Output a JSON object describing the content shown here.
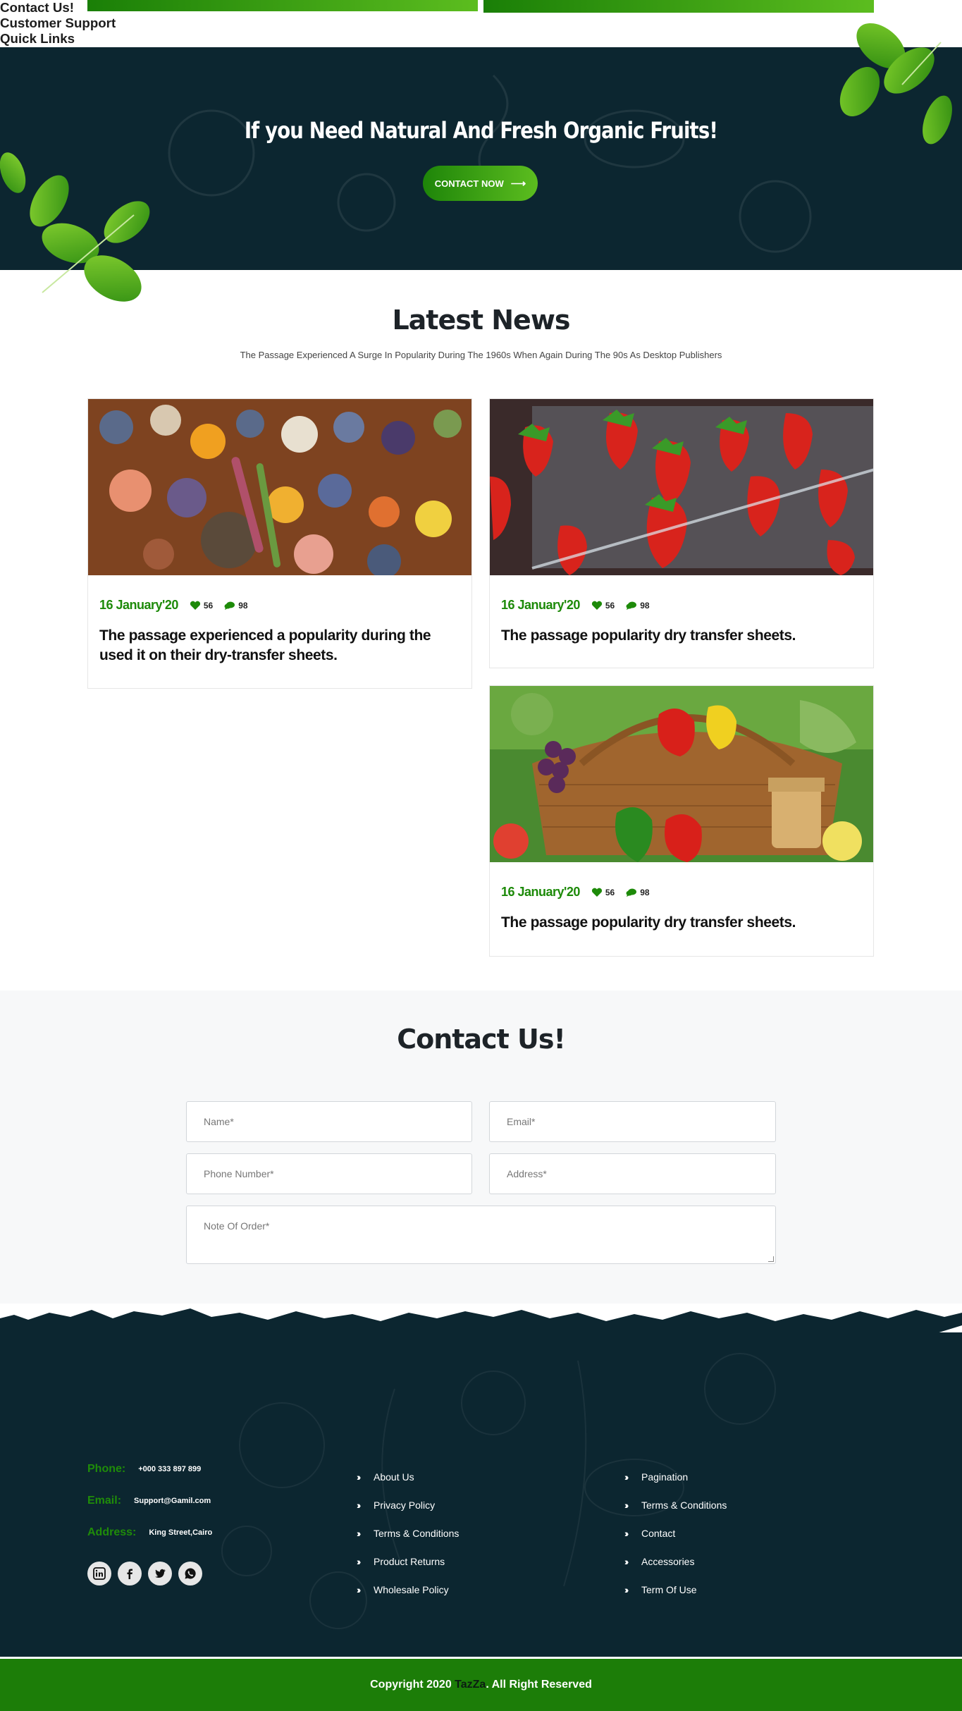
{
  "colors": {
    "brand_green": "#1d8a09",
    "dark_navy": "#0c2630",
    "footer_green": "#1c7d08",
    "light_bg": "#f7f8f9"
  },
  "hero": {
    "title": "If you Need Natural And Fresh Organic Fruits!",
    "button_label": "CONTACT NOW",
    "button_icon": "arrow-right-icon"
  },
  "news": {
    "title": "Latest News",
    "subtitle": "The Passage Experienced A Surge In Popularity During The 1960s When Again During The 90s As Desktop Publishers",
    "cards": [
      {
        "date": "16 January'20",
        "likes": "56",
        "comments": "98",
        "headline": "The passage experienced a popularity during the used it on their dry-transfer sheets.",
        "image": "mixed fruits and vegetables on wooden table"
      },
      {
        "date": "16 January'20",
        "likes": "56",
        "comments": "98",
        "headline": "The passage popularity dry transfer sheets.",
        "image": "strawberries in plastic container"
      },
      {
        "date": "16 January'20",
        "likes": "56",
        "comments": "98",
        "headline": "The passage popularity dry transfer sheets.",
        "image": "wicker basket of vegetables"
      }
    ]
  },
  "contact_form": {
    "title": "Contact Us!",
    "name_placeholder": "Name*",
    "email_placeholder": "Email*",
    "phone_placeholder": "Phone Number*",
    "address_placeholder": "Address*",
    "note_placeholder": "Note Of Order*"
  },
  "footer": {
    "contact": {
      "title": "Contact Us!",
      "phone_label": "Phone:",
      "phone": "+000 333 897 899",
      "email_label": "Email:",
      "email": "Support@Gamil.com",
      "address_label": "Address:",
      "address": "King Street,Cairo",
      "social": [
        "linkedin-icon",
        "facebook-icon",
        "twitter-icon",
        "whatsapp-icon"
      ]
    },
    "support": {
      "title": "Customer Support",
      "links": [
        "About Us",
        "Privacy Policy",
        "Terms & Conditions",
        "Product Returns",
        "Wholesale Policy"
      ]
    },
    "quick_links": {
      "title": "Quick Links",
      "links": [
        "Pagination",
        "Terms & Conditions",
        "Contact",
        "Accessories",
        "Term Of Use"
      ]
    },
    "copyright_prefix": "Copyright 2020 ",
    "copyright_brand": "TazZa",
    "copyright_suffix": ". All Right Reserved"
  }
}
